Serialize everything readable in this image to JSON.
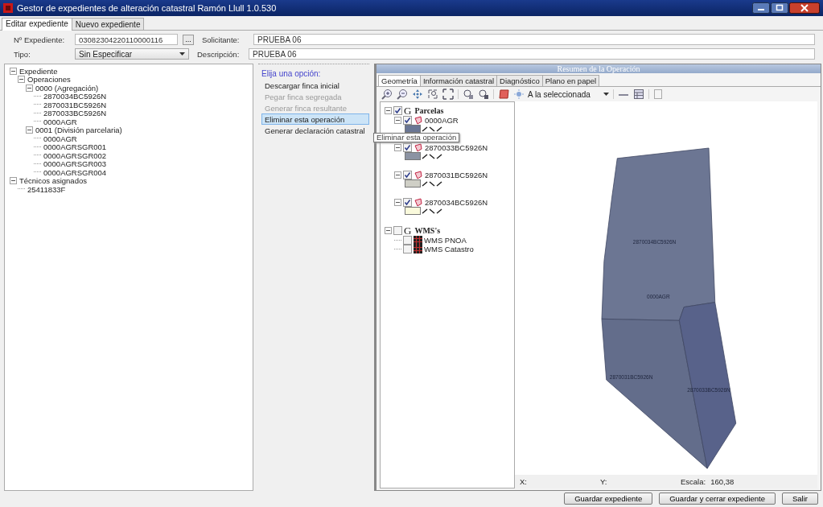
{
  "window": {
    "title": "Gestor de expedientes de alteración catastral Ramón Llull 1.0.530"
  },
  "tabs": [
    {
      "label": "Editar expediente",
      "selected": true
    },
    {
      "label": "Nuevo expediente",
      "selected": false
    }
  ],
  "form": {
    "expediente": {
      "label": "Nº Expediente:",
      "value": "03082304220110000116",
      "button": "..."
    },
    "solicitante": {
      "label": "Solicitante:",
      "value": "PRUEBA 06"
    },
    "tipo": {
      "label": "Tipo:",
      "value": "Sin Especificar"
    },
    "descripcion": {
      "label": "Descripción:",
      "value": "PRUEBA 06"
    }
  },
  "tree": [
    {
      "label": "Expediente",
      "expanded": true,
      "children": [
        {
          "label": "Operaciones",
          "expanded": true,
          "children": [
            {
              "label": "0000 (Agregación)",
              "expanded": true,
              "children": [
                {
                  "label": "2870034BC5926N"
                },
                {
                  "label": "2870031BC5926N"
                },
                {
                  "label": "2870033BC5926N"
                },
                {
                  "label": "0000AGR"
                }
              ]
            },
            {
              "label": "0001 (División parcelaria)",
              "expanded": true,
              "children": [
                {
                  "label": "0000AGR"
                },
                {
                  "label": "0000AGRSGR001"
                },
                {
                  "label": "0000AGRSGR002"
                },
                {
                  "label": "0000AGRSGR003"
                },
                {
                  "label": "0000AGRSGR004"
                }
              ]
            }
          ]
        }
      ]
    },
    {
      "label": "Técnicos asignados",
      "expanded": true,
      "children": [
        {
          "label": "25411833F"
        }
      ]
    }
  ],
  "options": {
    "heading": "Elija una opción:",
    "items": [
      {
        "label": "Descargar finca inicial",
        "disabled": false,
        "selected": false
      },
      {
        "label": "Pegar finca segregada",
        "disabled": true,
        "selected": false
      },
      {
        "label": "Generar finca resultante",
        "disabled": true,
        "selected": false
      },
      {
        "label": "Eliminar esta operación",
        "disabled": false,
        "selected": true
      },
      {
        "label": "Generar declaración catastral",
        "disabled": false,
        "selected": false
      }
    ],
    "tooltip": "Eliminar esta operación"
  },
  "summary": {
    "title": "Resumen de la Operación",
    "tabs": [
      {
        "label": "Geometría",
        "selected": true
      },
      {
        "label": "Información catastral",
        "selected": false
      },
      {
        "label": "Diagnóstico",
        "selected": false
      },
      {
        "label": "Plano en papel",
        "selected": false
      }
    ],
    "toolbar": {
      "dropdown": "A la seleccionada"
    },
    "layers": [
      {
        "label": "Parcelas",
        "glyph": "G",
        "checked": true,
        "expanded": true,
        "children": [
          {
            "label": "0000AGR",
            "checked": true,
            "color": "#6a7694"
          },
          {
            "label": "2870033BC5926N",
            "checked": true,
            "color": "#8c93a3"
          },
          {
            "label": "2870031BC5926N",
            "checked": true,
            "color": "#cfcfc6"
          },
          {
            "label": "2870034BC5926N",
            "checked": true,
            "color": "#fafadc"
          }
        ]
      },
      {
        "label": "WMS's",
        "glyph": "G",
        "checked": false,
        "expanded": true,
        "children": [
          {
            "label": "WMS PNOA",
            "checked": false
          },
          {
            "label": "WMS Catastro",
            "checked": false
          }
        ]
      }
    ],
    "map": {
      "labels": [
        "2870034BC5926N",
        "0000AGR",
        "2870031BC5926N",
        "2870033BC5926N"
      ]
    },
    "status": {
      "x_label": "X:",
      "y_label": "Y:",
      "scale_label": "Escala:",
      "scale_value": "160,38"
    }
  },
  "buttons": [
    "Guardar expediente",
    "Guardar y cerrar expediente",
    "Salir"
  ]
}
